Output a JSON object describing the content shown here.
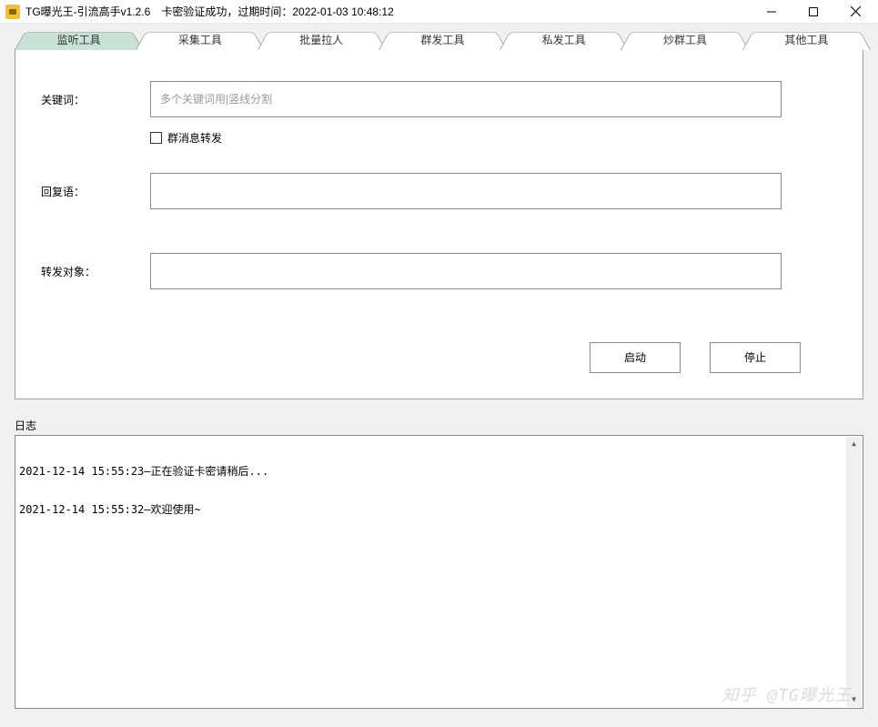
{
  "titlebar": {
    "text": "TG曝光王-引流高手v1.2.6　卡密验证成功，过期时间：2022-01-03 10:48:12"
  },
  "tabs": [
    {
      "label": "监听工具",
      "active": true
    },
    {
      "label": "采集工具",
      "active": false
    },
    {
      "label": "批量拉人",
      "active": false
    },
    {
      "label": "群发工具",
      "active": false
    },
    {
      "label": "私发工具",
      "active": false
    },
    {
      "label": "炒群工具",
      "active": false
    },
    {
      "label": "其他工具",
      "active": false
    }
  ],
  "form": {
    "keyword_label": "关键词：",
    "keyword_placeholder": "多个关键词用|竖线分割",
    "keyword_value": "",
    "forward_checkbox_label": "群消息转发",
    "forward_checked": false,
    "reply_label": "回复语：",
    "reply_value": "",
    "target_label": "转发对象：",
    "target_value": ""
  },
  "buttons": {
    "start": "启动",
    "stop": "停止"
  },
  "log": {
    "title": "日志",
    "lines": [
      "2021-12-14 15:55:23—正在验证卡密请稍后...",
      "2021-12-14 15:55:32—欢迎使用~"
    ]
  },
  "watermark": "知乎 @TG曝光王"
}
